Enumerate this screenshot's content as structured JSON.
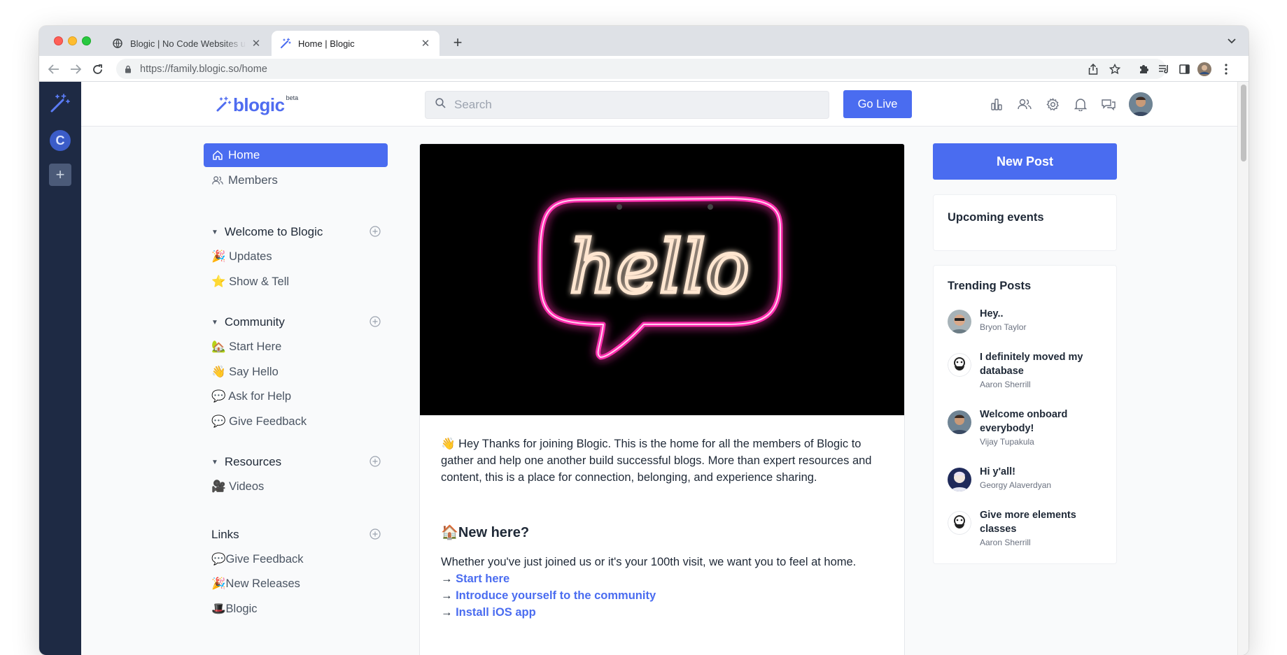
{
  "browser": {
    "tabs": [
      {
        "title": "Blogic | No Code Websites using Notion",
        "active": false,
        "favicon": "globe-icon"
      },
      {
        "title": "Home | Blogic",
        "active": true,
        "favicon": "blogic-wand-icon"
      }
    ],
    "url_host": "https://family.blogic.so",
    "url_path": "/home"
  },
  "rail": {
    "workspace_initial": "C",
    "add_label": "+"
  },
  "header": {
    "logo_text": "blogic",
    "logo_badge": "beta",
    "search_placeholder": "Search",
    "go_live_label": "Go Live",
    "icons": [
      "analytics-icon",
      "members-icon",
      "settings-icon",
      "bell-icon",
      "chat-icon"
    ]
  },
  "sidebar": {
    "home_label": "Home",
    "members_label": "Members",
    "sections": [
      {
        "title": "Welcome to Blogic",
        "items": [
          "🎉 Updates",
          "⭐ Show & Tell"
        ]
      },
      {
        "title": "Community",
        "items": [
          "🏡 Start Here",
          "👋 Say Hello",
          "💬 Ask for Help",
          "💬 Give Feedback"
        ]
      },
      {
        "title": "Resources",
        "items": [
          "🎥 Videos"
        ]
      }
    ],
    "links": {
      "title": "Links",
      "items": [
        "💬Give Feedback",
        "🎉New Releases",
        "🎩Blogic"
      ]
    }
  },
  "feed": {
    "hero_text": "hello",
    "intro": "👋 Hey Thanks for joining Blogic. This is the home for all the members of Blogic to gather and help one another build successful blogs. More than expert resources and content, this is a place for connection, belonging, and experience sharing.",
    "new_here_title": "🏠New here?",
    "new_here_text": "Whether you've just joined us or it's your 100th visit, we want you to feel at home.",
    "arrow": "→",
    "links": [
      "Start here",
      "Introduce yourself to the community",
      "Install iOS app"
    ]
  },
  "right": {
    "new_post_label": "New Post",
    "events_title": "Upcoming events",
    "trending_title": "Trending Posts",
    "trending": [
      {
        "title": "Hey..",
        "author": "Bryon Taylor"
      },
      {
        "title": "I definitely moved my database",
        "author": "Aaron Sherrill"
      },
      {
        "title": "Welcome onboard everybody!",
        "author": "Vijay Tupakula"
      },
      {
        "title": "Hi y'all!",
        "author": "Georgy Alaverdyan"
      },
      {
        "title": "Give more elements classes",
        "author": "Aaron Sherrill"
      }
    ]
  },
  "colors": {
    "accent": "#4a6cf0",
    "rail": "#1e2a44",
    "neon_pink": "#ff2fae"
  }
}
